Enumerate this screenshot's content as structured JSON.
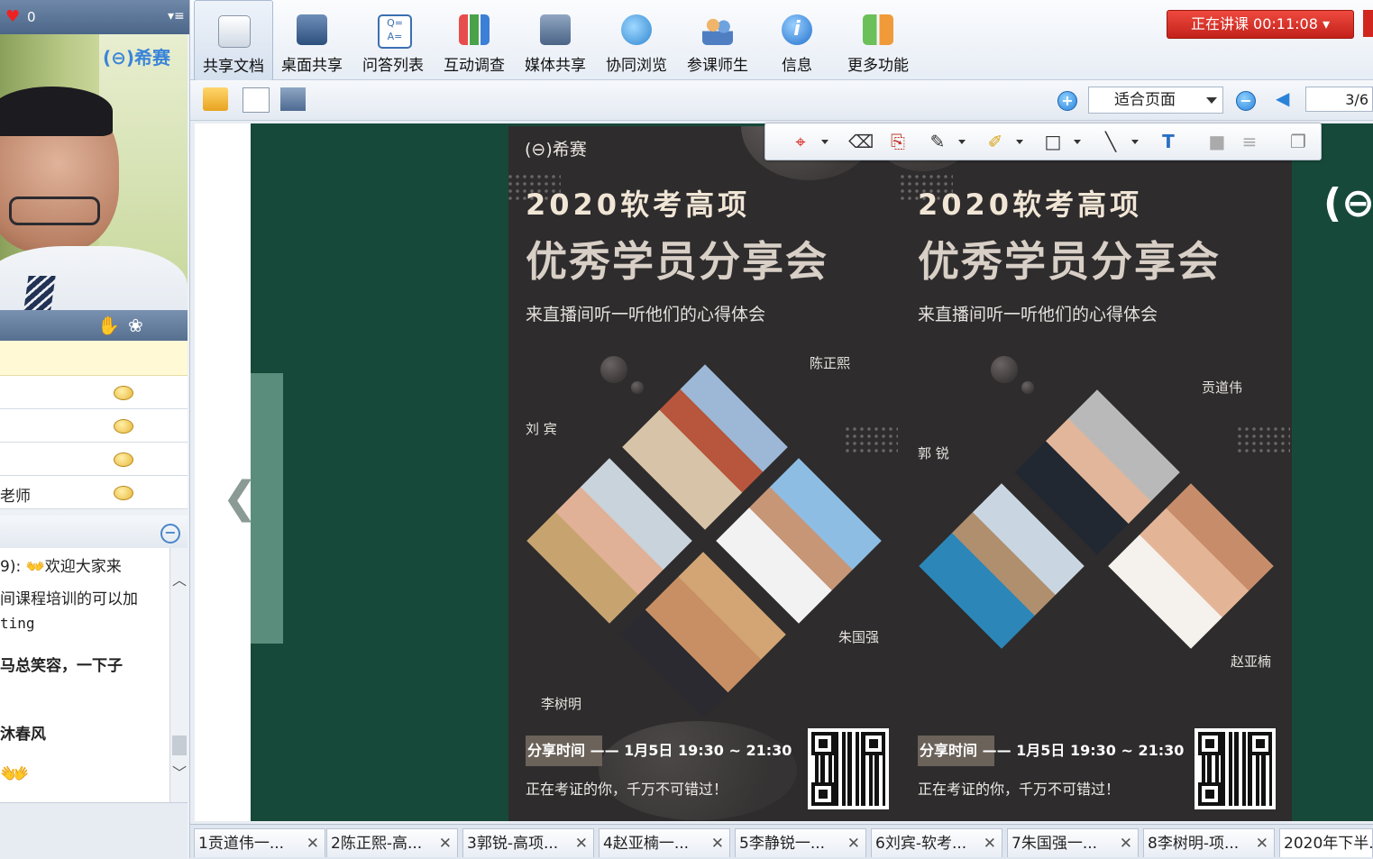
{
  "left_panel": {
    "like_count": "0",
    "video_logo": "(⊖)希赛",
    "users": [
      {
        "name": ""
      },
      {
        "name": ""
      },
      {
        "name": ""
      },
      {
        "name": "老师"
      }
    ],
    "chat": [
      {
        "text": "9):  👐欢迎大家来"
      },
      {
        "text": "间课程培训的可以加"
      },
      {
        "text": "ting"
      },
      {
        "text": "马总笑容，一下子",
        "bold": true
      },
      {
        "text": "沐春风",
        "bold": true
      }
    ]
  },
  "toolbar": {
    "items": [
      {
        "label": "共享文档"
      },
      {
        "label": "桌面共享"
      },
      {
        "label": "问答列表"
      },
      {
        "label": "互动调查"
      },
      {
        "label": "媒体共享"
      },
      {
        "label": "协同浏览"
      },
      {
        "label": "参课师生"
      },
      {
        "label": "信息"
      },
      {
        "label": "更多功能"
      }
    ],
    "live_status": "正在讲课 00:11:08 ▾"
  },
  "doc_bar": {
    "zoom": "适合页面",
    "page": "3/6"
  },
  "poster": {
    "logo": "(⊖)希赛",
    "panels": [
      {
        "title1": "2020软考高项",
        "title2": "优秀学员分享会",
        "subtitle": "来直播间听一听他们的心得体会",
        "names": [
          "陈正熙",
          "刘 宾",
          "朱国强",
          "李树明"
        ],
        "time": "分享时间 —— 1月5日 19:30 ~ 21:30",
        "footer": "正在考证的你，千万不可错过！"
      },
      {
        "title1": "2020软考高项",
        "title2": "优秀学员分享会",
        "subtitle": "来直播间听一听他们的心得体会",
        "names": [
          "贡道伟",
          "郭 锐",
          "赵亚楠"
        ],
        "time": "分享时间 —— 1月5日 19:30 ~ 21:30",
        "footer": "正在考证的你，千万不可错过！"
      }
    ]
  },
  "tabs": [
    {
      "label": "1贡道伟一..."
    },
    {
      "label": "2陈正熙-高..."
    },
    {
      "label": "3郭锐-高项..."
    },
    {
      "label": "4赵亚楠一..."
    },
    {
      "label": "5李静锐一..."
    },
    {
      "label": "6刘宾-软考..."
    },
    {
      "label": "7朱国强一..."
    },
    {
      "label": "8李树明-项..."
    },
    {
      "label": "2020年下半..."
    }
  ],
  "colors": {
    "live_red": "#d1261d",
    "doc_bg": "#17493a",
    "poster_bg": "#2e2c2d"
  }
}
